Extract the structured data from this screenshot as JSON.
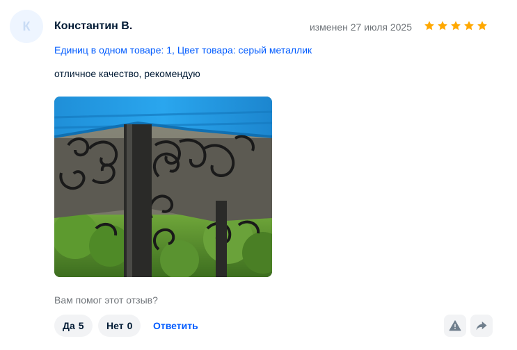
{
  "review": {
    "avatar_letter": "К",
    "author": "Константин В.",
    "date": "изменен 27 июля 2025",
    "rating": 5,
    "rating_max": 5,
    "star_color": "#ffa800",
    "meta": "Единиц в одном товаре: 1, Цвет товара: серый металлик",
    "text": "отличное качество, рекомендую",
    "photo_description_icon": "gazebo-photo"
  },
  "feedback": {
    "question": "Вам помог этот отзыв?",
    "yes_label": "Да",
    "yes_count": "5",
    "no_label": "Нет",
    "no_count": "0",
    "reply_label": "Ответить"
  },
  "actions": {
    "report_icon": "warning-icon",
    "share_icon": "share-arrow-icon"
  },
  "colors": {
    "accent": "#005bff",
    "text_primary": "#001a34",
    "text_secondary": "#70757a",
    "chip_bg": "#f2f3f5"
  }
}
